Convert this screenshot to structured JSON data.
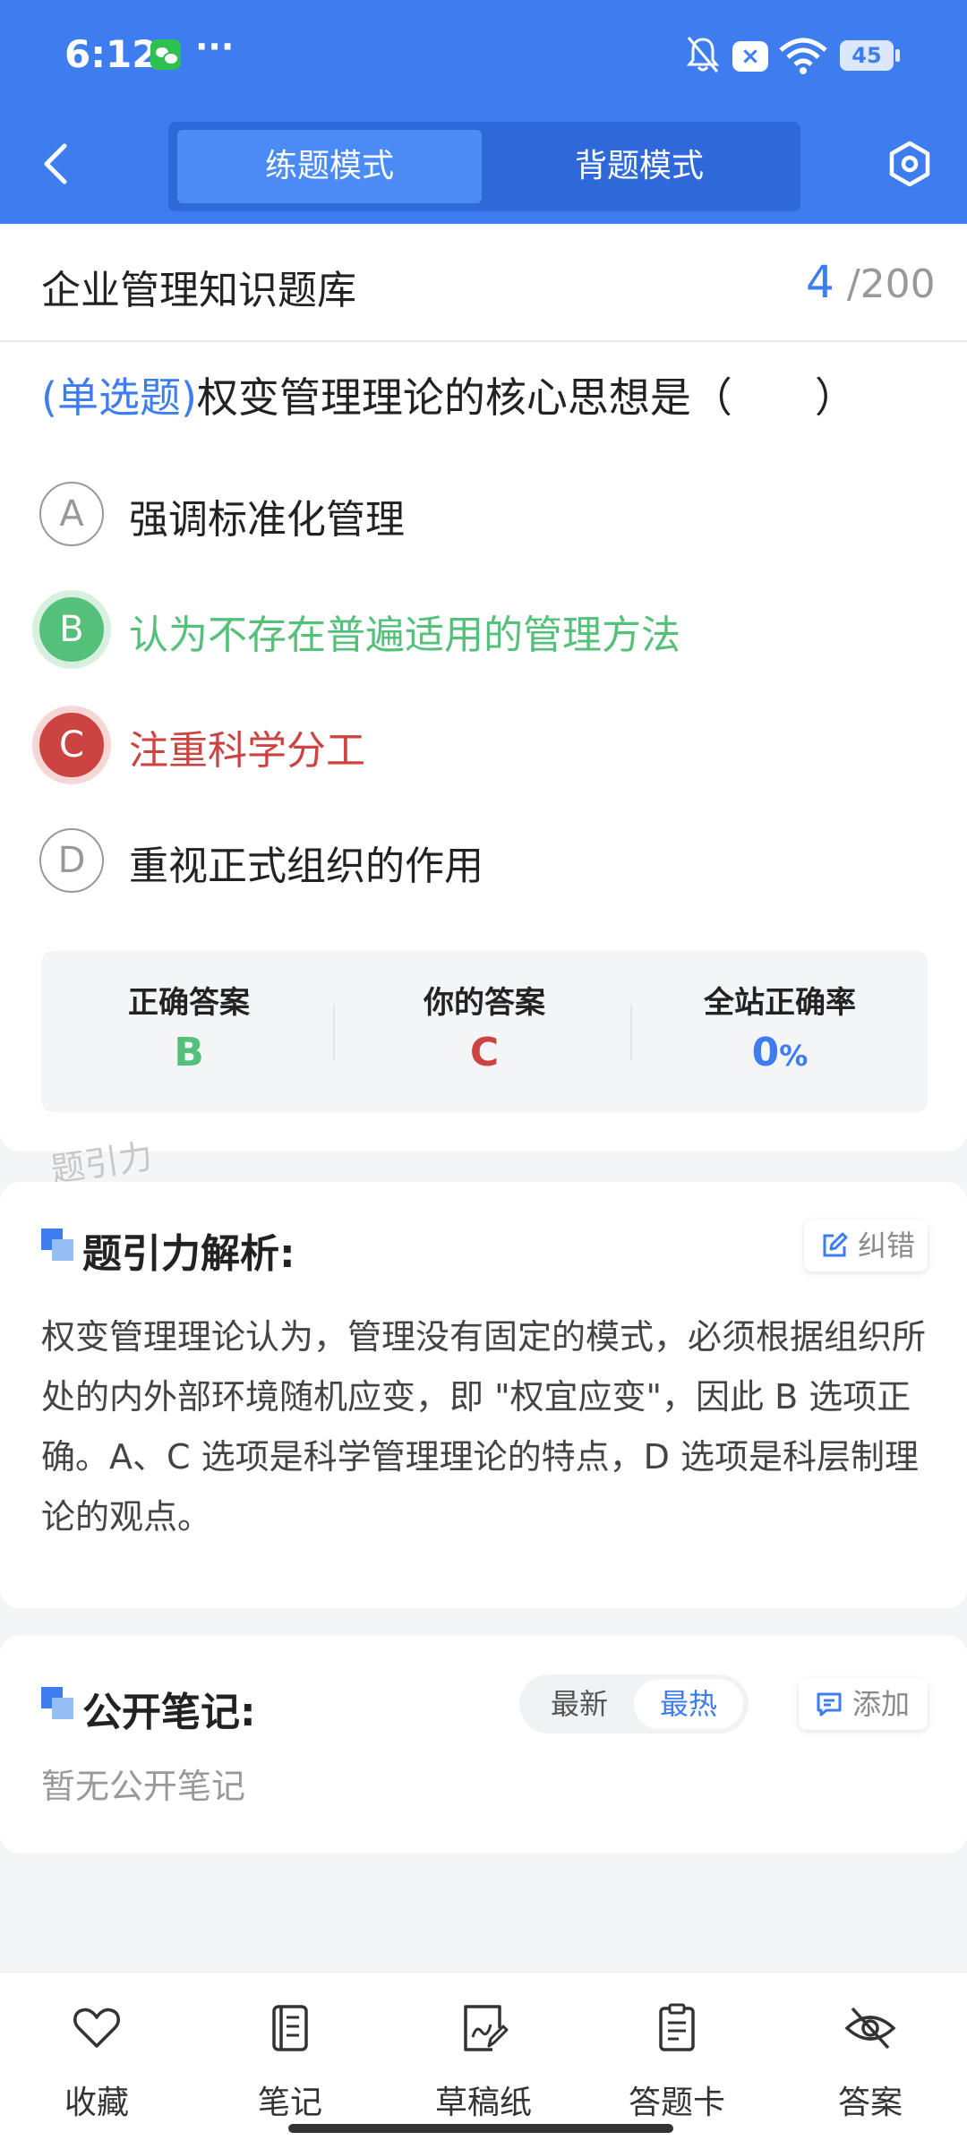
{
  "status_bar": {
    "time": "6:12",
    "more": "···",
    "close_badge": "×",
    "battery": "45"
  },
  "header": {
    "tabs": [
      {
        "label": "练题模式",
        "active": true
      },
      {
        "label": "背题模式",
        "active": false
      }
    ],
    "accent_color": "#3d7df0"
  },
  "question_bank": {
    "title": "企业管理知识题库",
    "current": "4",
    "separator": "/",
    "total": "200"
  },
  "question": {
    "type": "(单选题)",
    "text": "权变管理理论的核心思想是（　　）",
    "options": [
      {
        "letter": "A",
        "text": "强调标准化管理",
        "state": "normal"
      },
      {
        "letter": "B",
        "text": "认为不存在普遍适用的管理方法",
        "state": "correct"
      },
      {
        "letter": "C",
        "text": "注重科学分工",
        "state": "wrong"
      },
      {
        "letter": "D",
        "text": "重视正式组织的作用",
        "state": "normal"
      }
    ]
  },
  "summary": {
    "correct_label": "正确答案",
    "correct_value": "B",
    "yours_label": "你的答案",
    "yours_value": "C",
    "rate_label": "全站正确率",
    "rate_value": "0",
    "rate_unit": "%",
    "correct_color": "#55c07a",
    "wrong_color": "#cc4442"
  },
  "watermark": "题引力",
  "analysis": {
    "title": "题引力解析:",
    "report_label": "纠错",
    "body": "权变管理理论认为，管理没有固定的模式，必须根据组织所处的内外部环境随机应变，即 \"权宜应变\"，因此 B 选项正确。A、C 选项是科学管理理论的特点，D 选项是科层制理论的观点。"
  },
  "notes": {
    "title": "公开笔记:",
    "sort_newest": "最新",
    "sort_hottest": "最热",
    "add_label": "添加",
    "empty": "暂无公开笔记"
  },
  "bottom_nav": [
    {
      "label": "收藏",
      "icon": "heart-icon"
    },
    {
      "label": "笔记",
      "icon": "notebook-icon"
    },
    {
      "label": "草稿纸",
      "icon": "draft-paper-icon"
    },
    {
      "label": "答题卡",
      "icon": "answer-sheet-icon"
    },
    {
      "label": "答案",
      "icon": "eye-off-icon"
    }
  ]
}
